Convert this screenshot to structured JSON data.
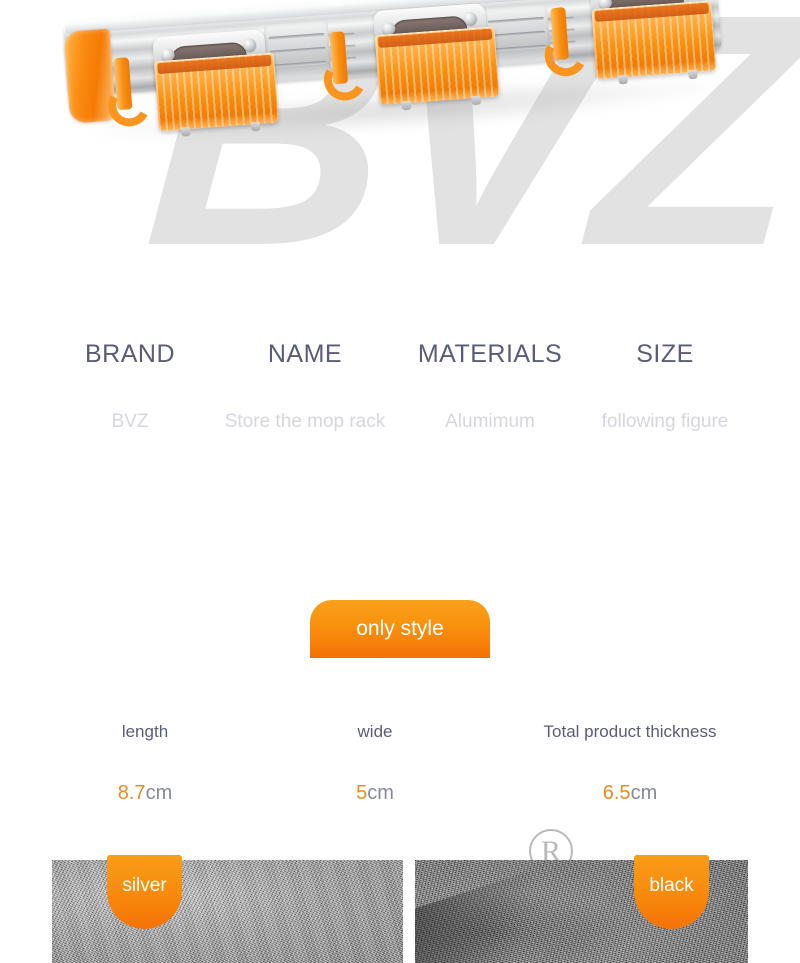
{
  "hero": {
    "watermark_text": "BVZ",
    "product_alt": "wall-mounted aluminium mop and broom storage rack with three orange clamp holders and hooks"
  },
  "spec_table": {
    "headers": [
      "BRAND",
      "NAME",
      "MATERIALS",
      "SIZE"
    ],
    "values": [
      "BVZ",
      "Store the mop rack",
      "Alumimum",
      "following figure"
    ]
  },
  "style_section": {
    "button_label": "only style"
  },
  "dimensions": {
    "labels": [
      "length",
      "wide",
      "Total product thickness"
    ],
    "numbers": [
      "8.7",
      "5",
      "6.5"
    ],
    "unit": "cm"
  },
  "colors": {
    "options": [
      {
        "label": "silver"
      },
      {
        "label": "black"
      }
    ],
    "registered_mark": "R"
  },
  "palette": {
    "accent_orange": "#f0891e",
    "button_orange_top": "#f9a01b",
    "button_orange_bottom": "#f36f05",
    "heading_slate": "#5a5d77",
    "value_gray": "#d6d7de",
    "watermark_gray": "#e2e2e2"
  }
}
